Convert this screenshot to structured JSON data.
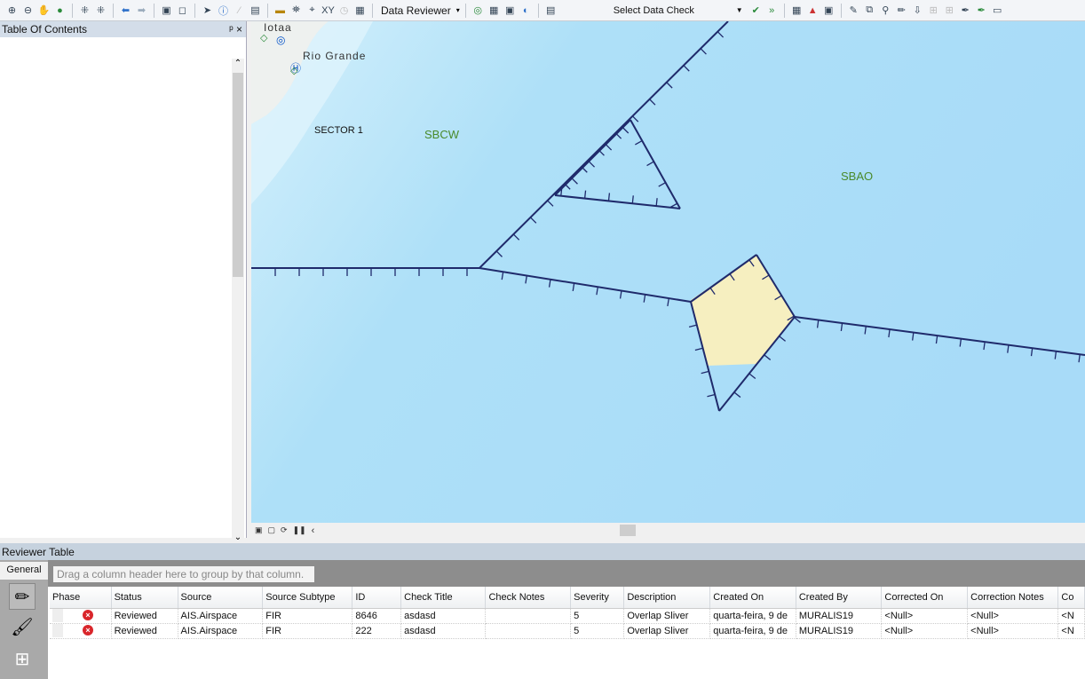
{
  "toolbar": {
    "data_reviewer": "Data Reviewer",
    "select_data_check": "Select Data Check"
  },
  "toc": {
    "title": "Table Of Contents",
    "pin": "ᵖ",
    "close": "×"
  },
  "map": {
    "labels": {
      "place1": "Iotaa",
      "place2": "Rio Grande",
      "sector": "SECTOR 1",
      "sbcw": "SBCW",
      "sbao": "SBAO"
    }
  },
  "reviewer": {
    "title": "Reviewer Table",
    "tab": "General",
    "group_hint": "Drag a column header here to group by that column.",
    "columns": [
      "Phase",
      "Status",
      "Source",
      "Source Subtype",
      "ID",
      "Check Title",
      "Check Notes",
      "Severity",
      "Description",
      "Created On",
      "Created By",
      "Corrected On",
      "Correction Notes",
      "Co"
    ],
    "rows": [
      [
        "",
        "Reviewed",
        "AIS.Airspace",
        "FIR",
        "8646",
        "asdasd",
        "",
        "5",
        "Overlap Sliver",
        "quarta-feira, 9 de",
        "MURALIS19",
        "<Null>",
        "<Null>",
        "<N"
      ],
      [
        "",
        "Reviewed",
        "AIS.Airspace",
        "FIR",
        "222",
        "asdasd",
        "",
        "5",
        "Overlap Sliver",
        "quarta-feira, 9 de",
        "MURALIS19",
        "<Null>",
        "<Null>",
        "<N"
      ]
    ]
  },
  "colors": {
    "line": "#1f2a6b",
    "sliver": "#f6efc0",
    "water": "#a9dcf7",
    "status_error": "#d9262b"
  }
}
